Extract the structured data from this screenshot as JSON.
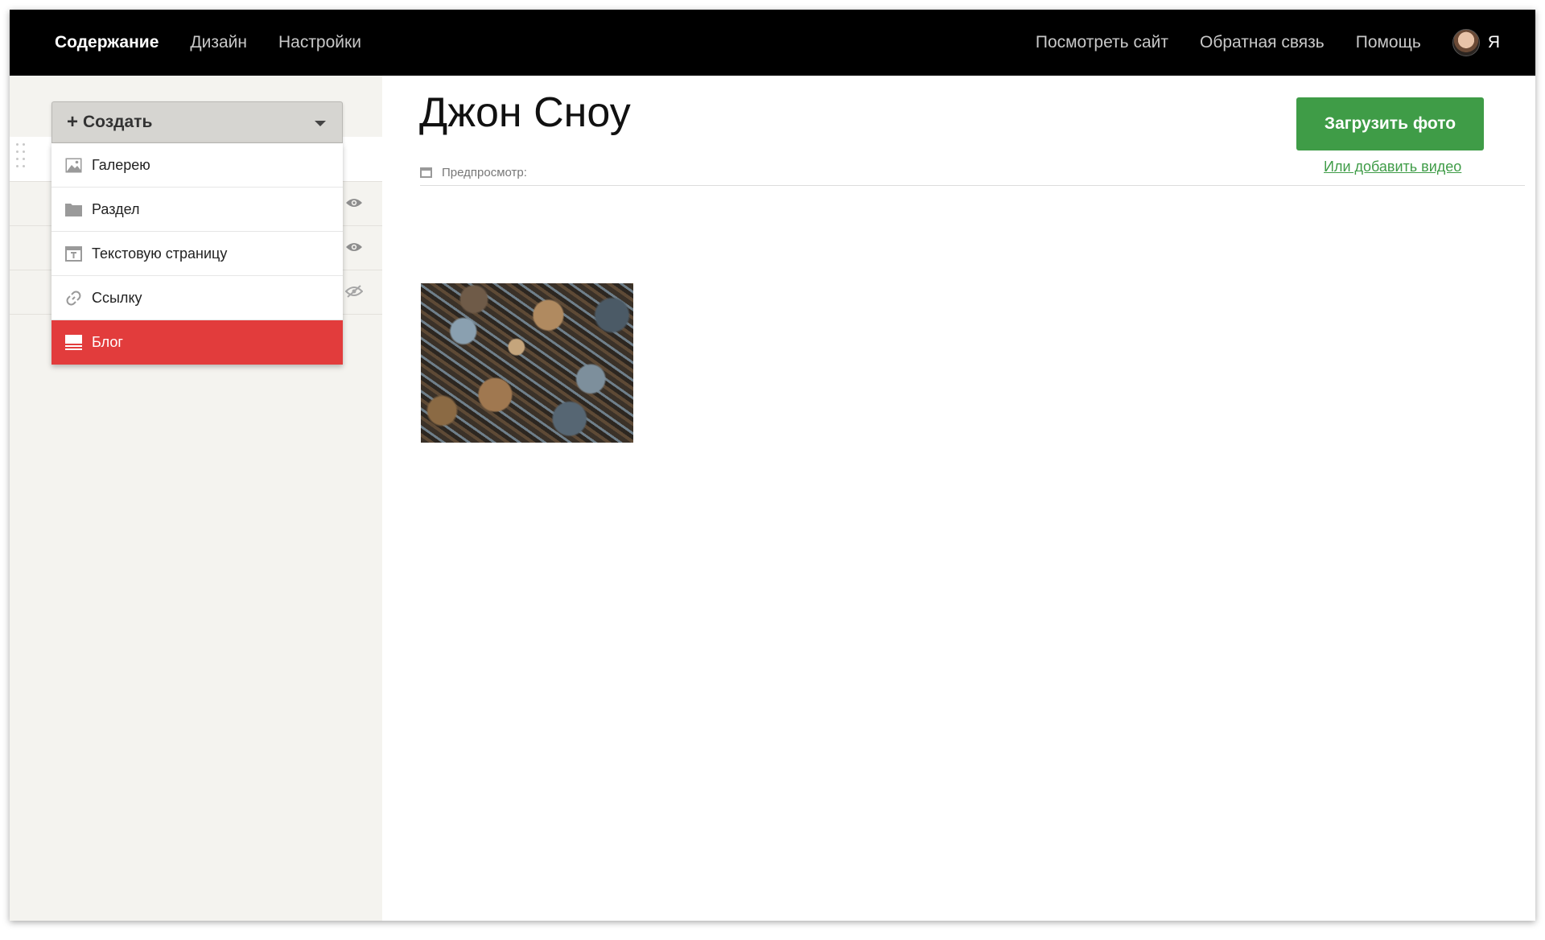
{
  "topbar": {
    "nav": [
      {
        "label": "Содержание",
        "active": true
      },
      {
        "label": "Дизайн",
        "active": false
      },
      {
        "label": "Настройки",
        "active": false
      }
    ],
    "right_links": [
      {
        "label": "Посмотреть сайт"
      },
      {
        "label": "Обратная связь"
      },
      {
        "label": "Помощь"
      }
    ],
    "user_label": "Я"
  },
  "create_menu": {
    "button_label": "Создать",
    "items": [
      {
        "label": "Галерею",
        "icon": "gallery-icon"
      },
      {
        "label": "Раздел",
        "icon": "folder-icon"
      },
      {
        "label": "Текстовую страницу",
        "icon": "text-page-icon"
      },
      {
        "label": "Ссылку",
        "icon": "link-icon"
      },
      {
        "label": "Блог",
        "icon": "blog-icon",
        "selected": true
      }
    ]
  },
  "main": {
    "title": "Джон Сноу",
    "preview_label": "Предпросмотр:",
    "upload_button": "Загрузить фото",
    "video_link": "Или добавить видео"
  },
  "colors": {
    "accent_green": "#3f9c47",
    "selected_red": "#e23c3c",
    "topbar": "#000000"
  }
}
